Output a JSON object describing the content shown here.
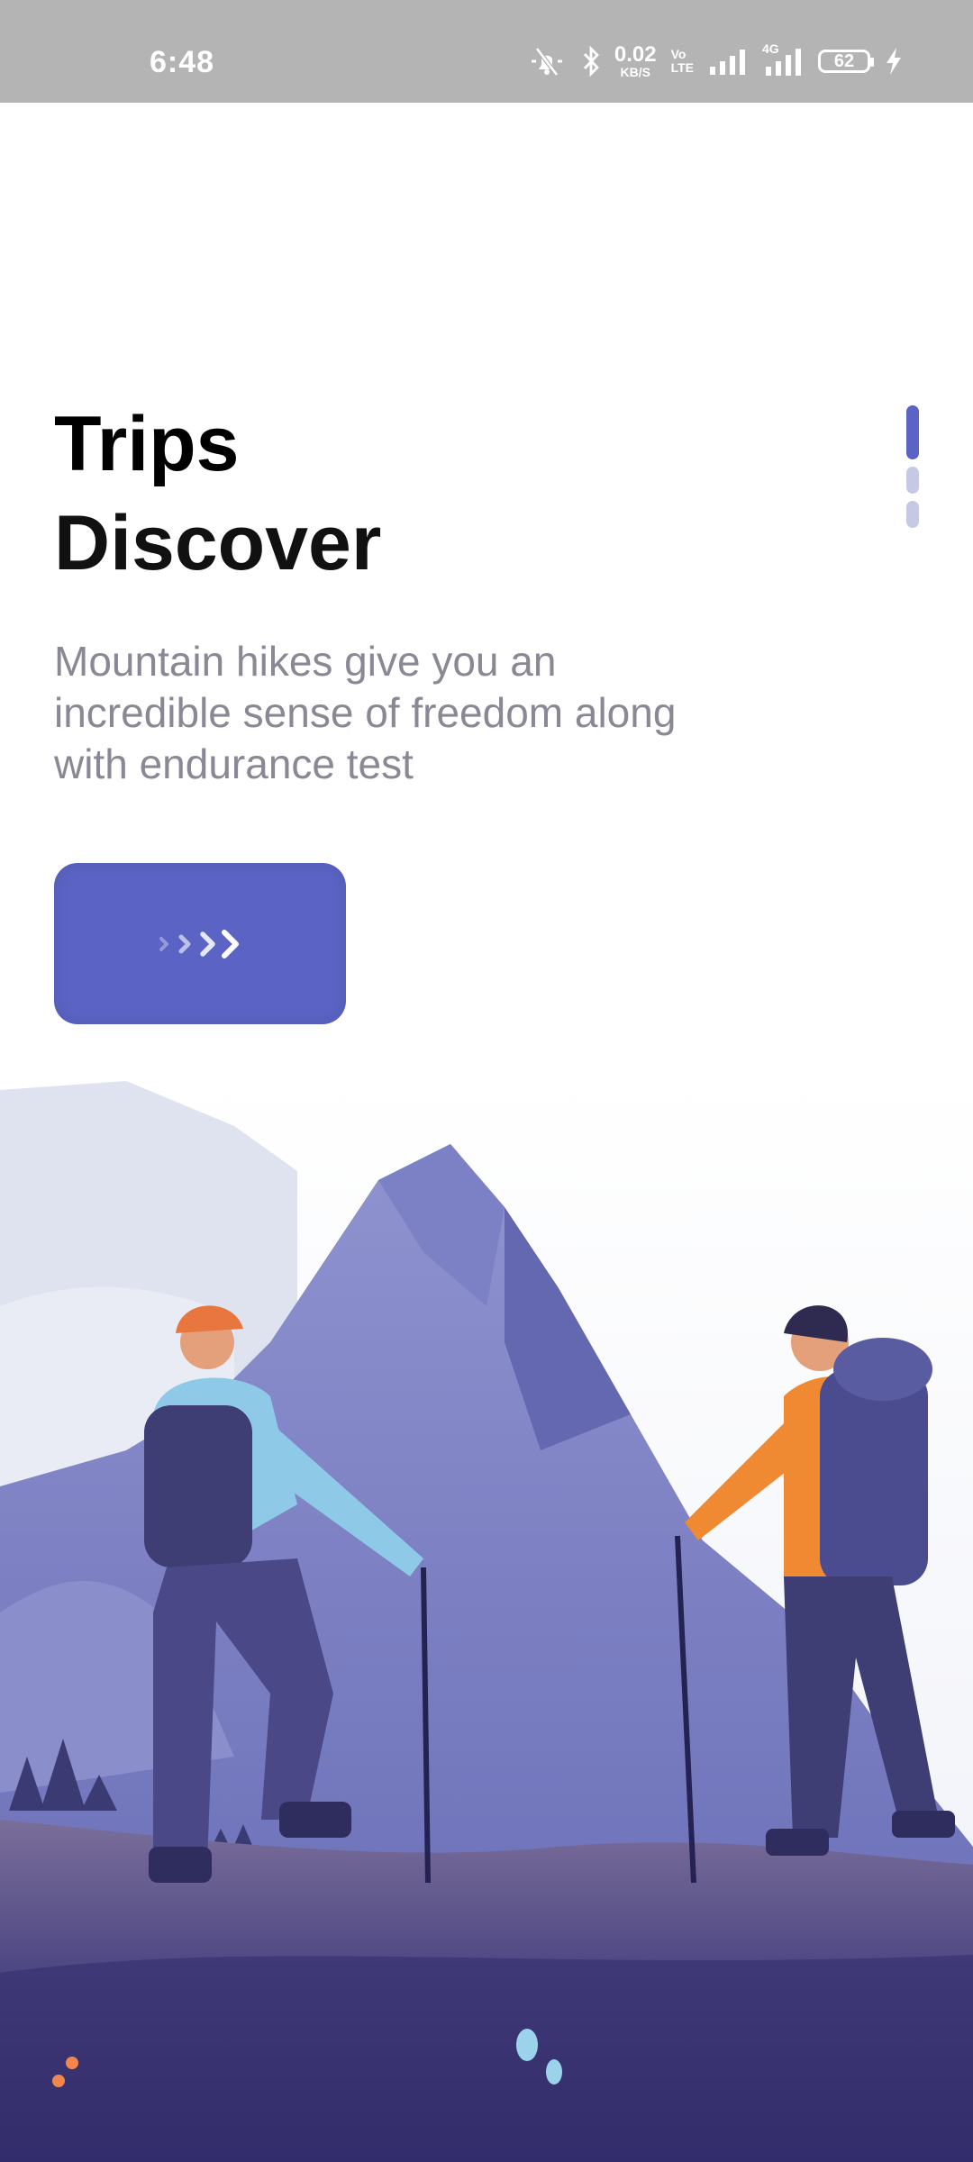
{
  "status_bar": {
    "time": "6:48",
    "net_speed_value": "0.02",
    "net_speed_unit": "KB/S",
    "volte_top": "Vo",
    "volte_bottom": "LTE",
    "network_type": "4G",
    "battery_level": "62"
  },
  "onboarding": {
    "title": "Trips",
    "subtitle": "Discover",
    "description": "Mountain hikes give you an incredible sense of freedom along with endurance test",
    "pages_total": 3,
    "current_page": 1
  },
  "next_button": {
    "icon": "chevrons-right-icon"
  },
  "colors": {
    "accent": "#5b63c4",
    "indicator_inactive": "#c5c9e4",
    "body_text": "#8a8894",
    "status_bar": "#b4b4b4"
  }
}
